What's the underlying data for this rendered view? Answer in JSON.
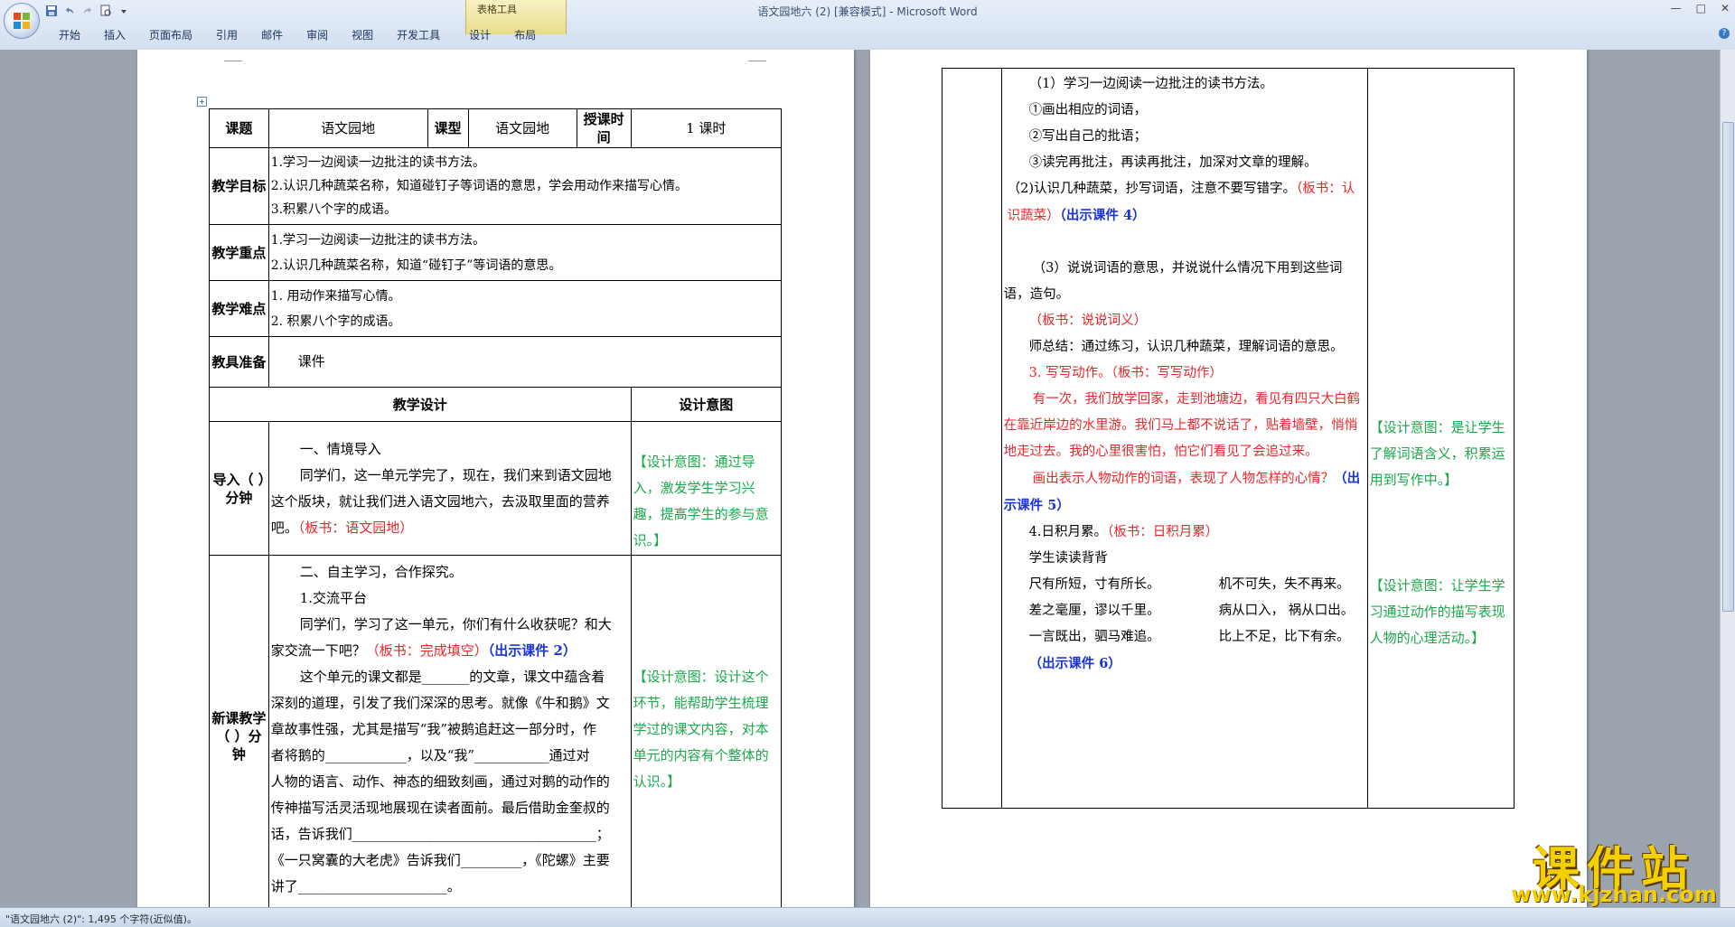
{
  "window": {
    "title": "语文园地六 (2) [兼容模式] - Microsoft Word",
    "context_tab_group": "表格工具",
    "controls": [
      "—",
      "□",
      "✕"
    ]
  },
  "ribbon": {
    "tabs": [
      "开始",
      "插入",
      "页面布局",
      "引用",
      "邮件",
      "审阅",
      "视图",
      "开发工具",
      "设计",
      "布局"
    ]
  },
  "status": {
    "text": "\"语文园地六 (2)\": 1,495 个字符(近似值)。"
  },
  "watermark": {
    "cn": "课件站",
    "url": "www.kjzhan.com"
  },
  "page1": {
    "header_row": {
      "ketilabel": "课题",
      "keti": "语文园地",
      "kexinglabel": "课型",
      "kexing": "语文园地",
      "shijianlabel": "授课时间",
      "shijian": "1 课时"
    },
    "goals_label": "教学目标",
    "goals": [
      "1.学习一边阅读一边批注的读书方法。",
      "2.认识几种蔬菜名称，知道碰钉子等词语的意思，学会用动作来描写心情。",
      "3.积累八个字的成语。"
    ],
    "focus_label": "教学重点",
    "focus": [
      "1.学习一边阅读一边批注的读书方法。",
      "2.认识几种蔬菜名称，知道“碰钉子”等词语的意思。"
    ],
    "difficulty_label": "教学难点",
    "difficulty": [
      "1. 用动作来描写心情。",
      "2. 积累八个字的成语。"
    ],
    "tools_label": "教具准备",
    "tools": "课件",
    "design_header": "教学设计",
    "intent_header": "设计意图",
    "intro_label": "导入（ ）分钟",
    "intro_lines": [
      "一、情境导入",
      "同学们，这一单元学完了，现在，我们来到语文园地",
      "这个版块，就让我们进入语文园地六，去汲取里面的营养",
      "吧。"
    ],
    "intro_board": "（板书：语文园地）",
    "intro_intent": "【设计意图：通过导入，激发学生学习兴趣，提高学生的参与意识。】",
    "new_label": "新课教学（ ）分钟",
    "new_lines": [
      "二、自主学习，合作探究。",
      "1.交流平台",
      "同学们，学习了这一单元，你们有什么收获呢？和大",
      "家交流一下吧？"
    ],
    "new_board": "（板书：完成填空）",
    "new_courseware": "（出示课件 2）",
    "new_para": [
      "这个单元的课文都是_______的文章，课文中蕴含着",
      "深刻的道理，引发了我们深深的思考。就像《牛和鹅》文",
      "章故事性强，尤其是描写“我”被鹅追赶这一部分时，作",
      "者将鹅的____________，以及“我”___________通过对",
      "人物的语言、动作、神态的细致刻画，通过对鹅的动作的",
      "传神描写活灵活现地展现在读者面前。最后借助金奎叔的",
      "话，告诉我们____________________________________；",
      "《一只窝囊的大老虎》告诉我们_________，《陀螺》主要",
      "讲了______________________。"
    ],
    "new_intent": "【设计意图：设计这个环节，能帮助学生梳理学过的课文内容，对本单元的内容有个整体的认识。】"
  },
  "page2": {
    "l1": "（1）学习一边阅读一边批注的读书方法。",
    "l2": "①画出相应的词语，",
    "l3": "②写出自己的批语；",
    "l4": "③读完再批注，再读再批注，加深对文章的理解。",
    "l5": "（2)认识几种蔬菜，抄写词语，注意不要写错字。",
    "l5_board": "（板书：认识蔬菜）",
    "l5_courseware": "（出示课件 4）",
    "l6": "（3）说说词语的意思，并说说什么情况下用到这些词语，造句。",
    "l7_board": "（板书：说说词义）",
    "l8": "师总结：通过练习，认识几种蔬菜，理解词语的意思。",
    "l9": "3. 写写动作。（板书：写写动作）",
    "l10": "有一次，我们放学回家，走到池塘边，看见有四只大白鹤在靠近岸边的水里游。我们马上都不说话了，贴着墙壁，悄悄地走过去。我的心里很害怕，怕它们看见了会追过来。",
    "l11": "画出表示人物动作的词语，表现了人物怎样的心情？",
    "l11_courseware": "（出示课件 5）",
    "l12": "4.日积月累。",
    "l12_board": "（板书：日积月累）",
    "l13": "学生读读背背",
    "idioms": [
      [
        "尺有所短，寸有所长。",
        "机不可失，失不再来。"
      ],
      [
        "差之毫厘，谬以千里。",
        "病从口入，  祸从口出。"
      ],
      [
        "一言既出，驷马难追。",
        "比上不足，比下有余。"
      ]
    ],
    "l14_courseware": "（出示课件 6）",
    "intent1": "【设计意图：是让学生了解词语含义，积累运用到写作中。】",
    "intent2": "【设计意图：让学生学习通过动作的描写表现人物的心理活动。】"
  }
}
